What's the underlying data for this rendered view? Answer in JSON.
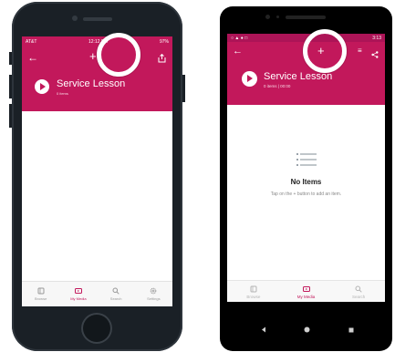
{
  "ios": {
    "status": {
      "carrier": "AT&T",
      "time": "12:12 PM",
      "battery": "97%"
    },
    "lesson": {
      "title": "Service Lesson",
      "subtitle": "0 items"
    },
    "tabs": [
      {
        "label": "Browse",
        "icon": "browse-icon",
        "active": false
      },
      {
        "label": "My Media",
        "icon": "media-icon",
        "active": true
      },
      {
        "label": "Search",
        "icon": "search-icon",
        "active": false
      },
      {
        "label": "Settings",
        "icon": "gear-icon",
        "active": false
      }
    ]
  },
  "android": {
    "status": {
      "time": "3:13"
    },
    "lesson": {
      "title": "Service Lesson",
      "subtitle": "0 items | 00:00"
    },
    "empty": {
      "title": "No Items",
      "message": "Tap on the + button to add an item."
    },
    "tabs": [
      {
        "label": "Browse",
        "icon": "browse-icon",
        "active": false
      },
      {
        "label": "My Media",
        "icon": "media-icon",
        "active": true
      },
      {
        "label": "Search",
        "icon": "search-icon",
        "active": false
      }
    ]
  },
  "colors": {
    "accent": "#c2185b",
    "status_dark": "#ad1457"
  }
}
